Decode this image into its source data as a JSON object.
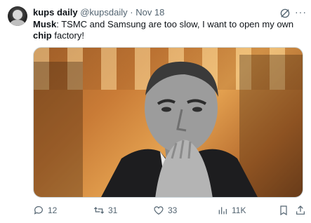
{
  "post": {
    "display_name": "kups daily",
    "handle": "@kupsdaily",
    "separator": "·",
    "date": "Nov 18",
    "text_lead": "Musk",
    "text_part1": ": TSMC and Samsung are too slow, I want to open my own ",
    "text_bold2": "chip",
    "text_part2": " factory!"
  },
  "actions": {
    "replies": "12",
    "reposts": "31",
    "likes": "33",
    "views": "11K"
  },
  "icons": {
    "grok": "grok-icon",
    "more": "more-icon",
    "reply": "reply-icon",
    "repost": "repost-icon",
    "like": "like-icon",
    "views": "views-icon",
    "bookmark": "bookmark-icon",
    "share": "share-icon"
  },
  "colors": {
    "text": "#0f1419",
    "muted": "#536471",
    "border": "#cfd9de"
  }
}
